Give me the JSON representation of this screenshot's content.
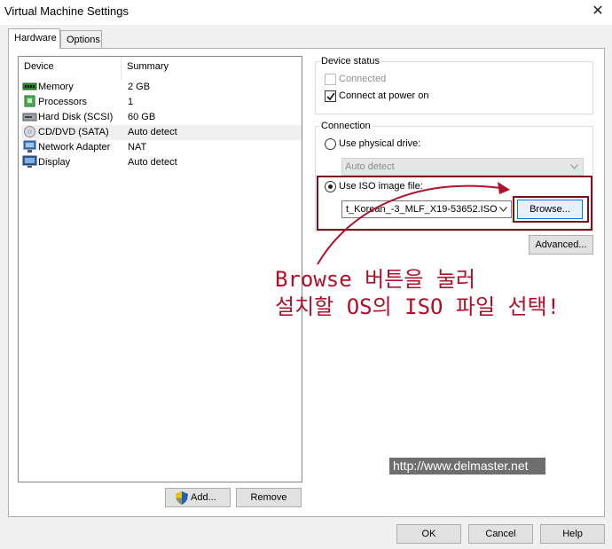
{
  "window": {
    "title": "Virtual Machine Settings",
    "close_glyph": "✕"
  },
  "tabs": [
    {
      "label": "Hardware",
      "active": true
    },
    {
      "label": "Options",
      "active": false
    }
  ],
  "device_list": {
    "columns": [
      "Device",
      "Summary"
    ],
    "rows": [
      {
        "device": "Memory",
        "summary": "2 GB",
        "icon": "memory-icon"
      },
      {
        "device": "Processors",
        "summary": "1",
        "icon": "processor-icon"
      },
      {
        "device": "Hard Disk (SCSI)",
        "summary": "60 GB",
        "icon": "hard-disk-icon"
      },
      {
        "device": "CD/DVD (SATA)",
        "summary": "Auto detect",
        "icon": "cd-dvd-icon",
        "selected": true
      },
      {
        "device": "Network Adapter",
        "summary": "NAT",
        "icon": "network-adapter-icon"
      },
      {
        "device": "Display",
        "summary": "Auto detect",
        "icon": "display-icon"
      }
    ]
  },
  "list_buttons": {
    "add": "Add...",
    "remove": "Remove"
  },
  "device_status": {
    "title": "Device status",
    "connected": {
      "label": "Connected",
      "checked": false,
      "enabled": false
    },
    "connect_at_power_on": {
      "label": "Connect at power on",
      "checked": true
    }
  },
  "connection": {
    "title": "Connection",
    "physical_drive": {
      "label": "Use physical drive:",
      "selected": false
    },
    "physical_drive_value": "Auto detect",
    "iso_image": {
      "label": "Use ISO image file:",
      "selected": true
    },
    "iso_path": "t_Korean_-3_MLF_X19-53652.ISO",
    "browse": "Browse..."
  },
  "advanced_button": "Advanced...",
  "annotation": {
    "line1": "Browse 버튼을 눌러",
    "line2": "설치할 OS의 ISO 파일 선택!",
    "color": "#b0102a"
  },
  "watermark": "http://www.delmaster.net",
  "footer_buttons": {
    "ok": "OK",
    "cancel": "Cancel",
    "help": "Help"
  }
}
